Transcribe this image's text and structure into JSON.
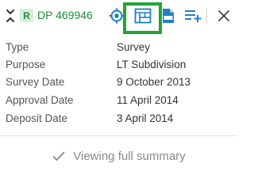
{
  "colors": {
    "accent": "#1f7fc2",
    "badge_bg": "#d7efd9",
    "badge_fg": "#1f8a3a",
    "plan_number": "#1f8a3a",
    "highlight": "#21a632"
  },
  "header": {
    "collapse_icon": "collapse-icon",
    "badge_label": "R",
    "plan_number": "DP 469946",
    "tools": [
      {
        "name": "locate-icon"
      },
      {
        "name": "plan-image-icon"
      },
      {
        "name": "pdf-document-icon"
      },
      {
        "name": "add-to-list-icon"
      }
    ],
    "close_icon": "close-icon"
  },
  "details": [
    {
      "label": "Type",
      "value": "Survey"
    },
    {
      "label": "Purpose",
      "value": "LT Subdivision"
    },
    {
      "label": "Survey Date",
      "value": "9 October 2013"
    },
    {
      "label": "Approval Date",
      "value": "11 April 2014"
    },
    {
      "label": "Deposit Date",
      "value": "3 April 2014"
    }
  ],
  "footer": {
    "icon": "check-icon",
    "label": "Viewing full summary"
  }
}
